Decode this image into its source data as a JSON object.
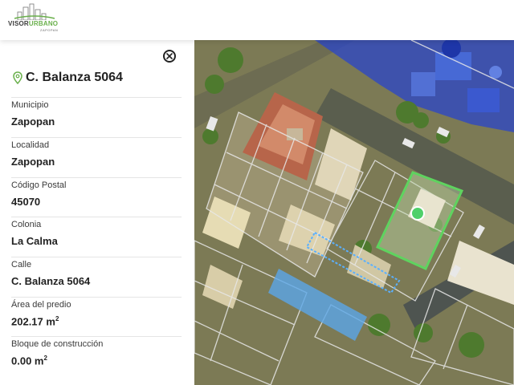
{
  "header": {
    "brand_part1": "VISOR",
    "brand_part2": "URBANO",
    "brand_sub": "ZAPOPAN",
    "brand_color": "#6ab04c"
  },
  "panel": {
    "close_icon": "close-circle-icon",
    "pin_icon": "map-pin-icon",
    "pin_color": "#6ab04c",
    "address": "C. Balanza 5064",
    "fields": [
      {
        "label": "Municipio",
        "value": "Zapopan"
      },
      {
        "label": "Localidad",
        "value": "Zapopan"
      },
      {
        "label": "Código Postal",
        "value": "45070"
      },
      {
        "label": "Colonia",
        "value": "La Calma"
      },
      {
        "label": "Calle",
        "value": "C. Balanza 5064"
      },
      {
        "label": "Área del predio",
        "value": "202.17 m",
        "unit_sup": "2"
      },
      {
        "label": "Bloque de construcción",
        "value": "0.00 m",
        "unit_sup": "2"
      }
    ]
  },
  "map": {
    "selected_parcel_color": "#5fd35f",
    "highlight_blue": "#4a90d9",
    "marker_icon": "location-dot-icon"
  }
}
